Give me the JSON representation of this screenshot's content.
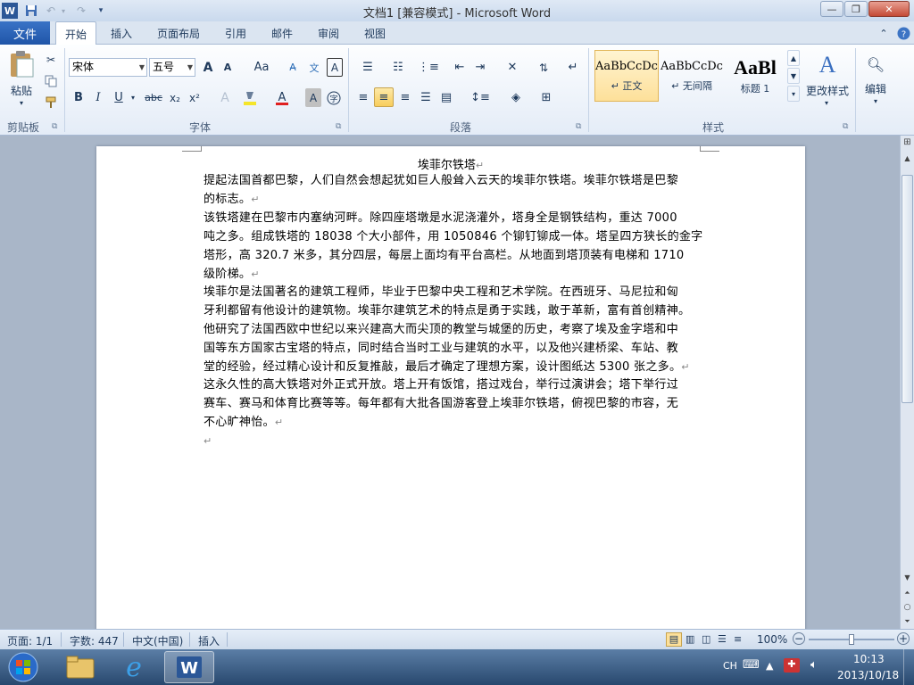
{
  "app": {
    "title": "文档1 [兼容模式] - Microsoft Word",
    "app_icon": "W"
  },
  "quick_access": {
    "save_icon": "save-icon",
    "undo_icon": "undo-icon",
    "redo_icon": "redo-icon",
    "customize_icon": "customize-icon"
  },
  "window_controls": {
    "minimize": "—",
    "maximize": "❐",
    "close": "✕"
  },
  "tabs": {
    "file": "文件",
    "items": [
      "开始",
      "插入",
      "页面布局",
      "引用",
      "邮件",
      "审阅",
      "视图"
    ],
    "active": "开始"
  },
  "ribbon": {
    "clipboard": {
      "paste_label": "粘贴",
      "group_label": "剪贴板"
    },
    "font": {
      "font_name": "宋体",
      "font_size": "五号",
      "grow": "A",
      "shrink": "A",
      "change_case": "Aa",
      "bold": "B",
      "italic": "I",
      "underline": "U",
      "strike": "abc",
      "subscript": "x₂",
      "superscript": "x²",
      "group_label": "字体"
    },
    "paragraph": {
      "group_label": "段落"
    },
    "styles": {
      "items": [
        {
          "preview": "AaBbCcDc",
          "name": "正文",
          "prefix": "↵"
        },
        {
          "preview": "AaBbCcDc",
          "name": "无间隔",
          "prefix": "↵"
        },
        {
          "preview": "AaBl",
          "name": "标题 1",
          "prefix": ""
        }
      ],
      "change_styles": "更改样式",
      "group_label": "样式"
    },
    "editing": {
      "label": "编辑"
    }
  },
  "document": {
    "title": "埃菲尔铁塔",
    "paragraphs": [
      [
        "提起法国首都巴黎，人们自然会想起犹如巨人般耸入云天的埃菲尔铁塔。埃菲尔铁塔是巴黎",
        "的标志。"
      ],
      [
        "该铁塔建在巴黎市内塞纳河畔。除四座塔墩是水泥浇灌外，塔身全是钢铁结构，重达 7000",
        "吨之多。组成铁塔的 18038 个大小部件，用 1050846 个铆钉铆成一体。塔呈四方狭长的金字",
        "塔形，高 320.7 米多，其分四层，每层上面均有平台高栏。从地面到塔顶装有电梯和 1710",
        "级阶梯。"
      ],
      [
        "埃菲尔是法国著名的建筑工程师，毕业于巴黎中央工程和艺术学院。在西班牙、马尼拉和匈",
        "牙利都留有他设计的建筑物。埃菲尔建筑艺术的特点是勇于实践，敢于革新，富有首创精神。",
        "他研究了法国西欧中世纪以来兴建高大而尖顶的教堂与城堡的历史，考察了埃及金字塔和中",
        "国等东方国家古宝塔的特点，同时结合当时工业与建筑的水平，以及他兴建桥梁、车站、教",
        "堂的经验，经过精心设计和反复推敲，最后才确定了理想方案，设计图纸达 5300 张之多。"
      ],
      [
        "这永久性的高大铁塔对外正式开放。塔上开有饭馆，搭过戏台，举行过演讲会；塔下举行过",
        "赛车、赛马和体育比赛等等。每年都有大批各国游客登上埃菲尔铁塔，俯视巴黎的市容，无",
        "不心旷神怡。"
      ]
    ],
    "para_mark": "↵"
  },
  "status": {
    "page": "页面: 1/1",
    "words": "字数: 447",
    "language": "中文(中国)",
    "mode": "插入",
    "zoom": "100%",
    "zoom_out": "−",
    "zoom_in": "+"
  },
  "taskbar": {
    "input_method": "CH",
    "time": "10:13",
    "date": "2013/10/18"
  }
}
